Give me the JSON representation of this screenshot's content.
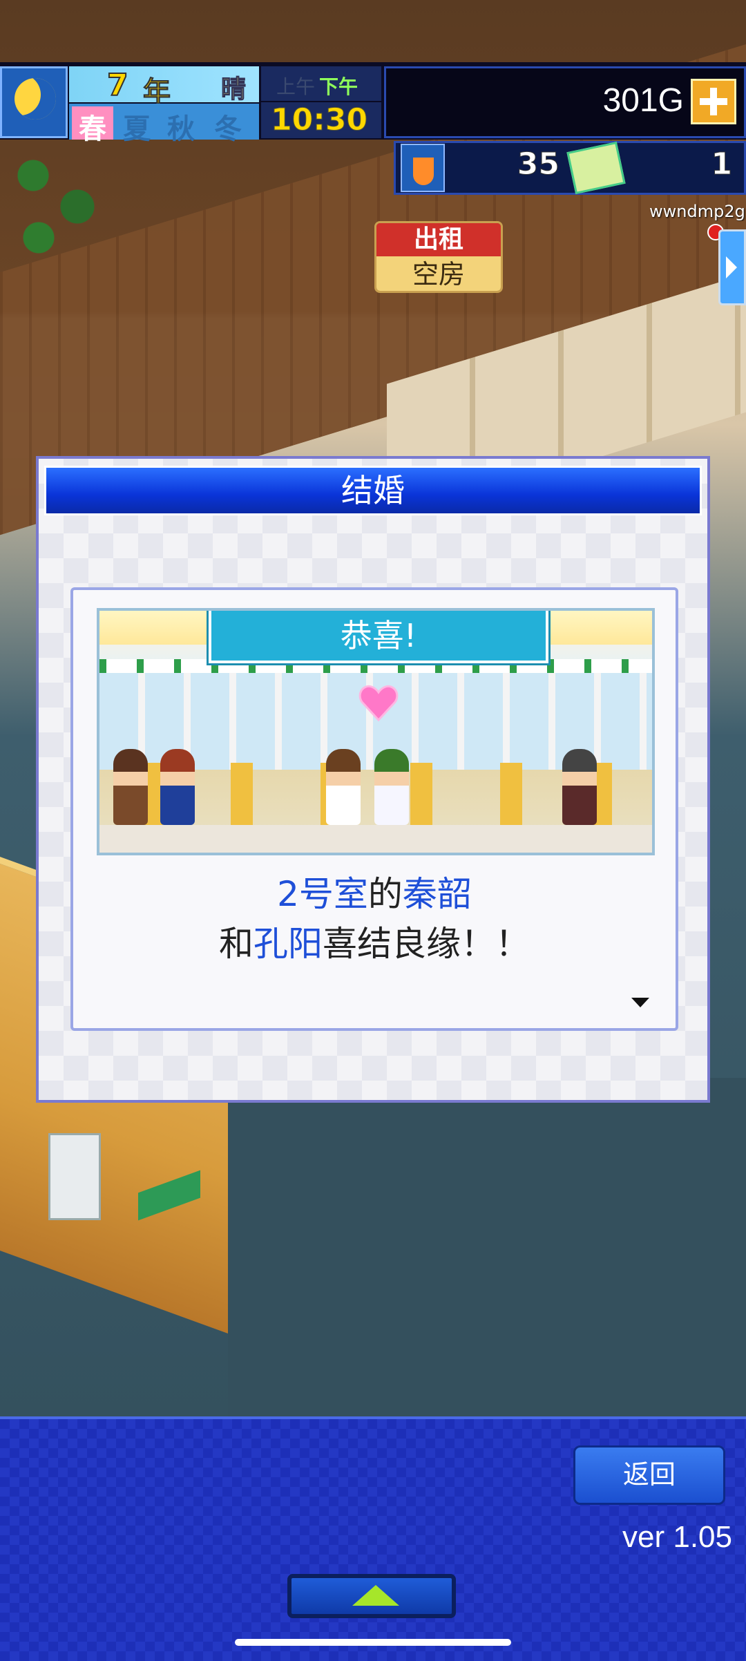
{
  "hud": {
    "year_number": "7",
    "year_label": "年",
    "weather": "晴",
    "am_label": "上午",
    "pm_label": "下午",
    "seasons": [
      "春",
      "夏",
      "秋",
      "冬"
    ],
    "active_season": "春",
    "time": "10:30",
    "gold": "301G",
    "resource_research": "35",
    "resource_tickets": "1",
    "username": "wwndmp2g",
    "colors": {
      "hud_bg": "#0b0b24",
      "gold_plus": "#f1a926",
      "time": "#ffd700"
    }
  },
  "world": {
    "rent_sign_top": "出租",
    "rent_sign_bottom": "空房"
  },
  "dialog": {
    "title": "结婚",
    "banner": "恭喜!",
    "message": {
      "room": "2号室",
      "particle": "的",
      "person1": "秦韶",
      "conjunction": "和",
      "person2": "孔阳",
      "tail": "喜结良缘！！"
    },
    "more_icon": "triangle-down-icon",
    "colors": {
      "title_bar": "#0a34d8",
      "highlight": "#1e4fd8",
      "banner": "#23b0d8"
    }
  },
  "bottom": {
    "back_label": "返回",
    "version": "ver 1.05",
    "up_icon": "up-arrow-icon"
  }
}
